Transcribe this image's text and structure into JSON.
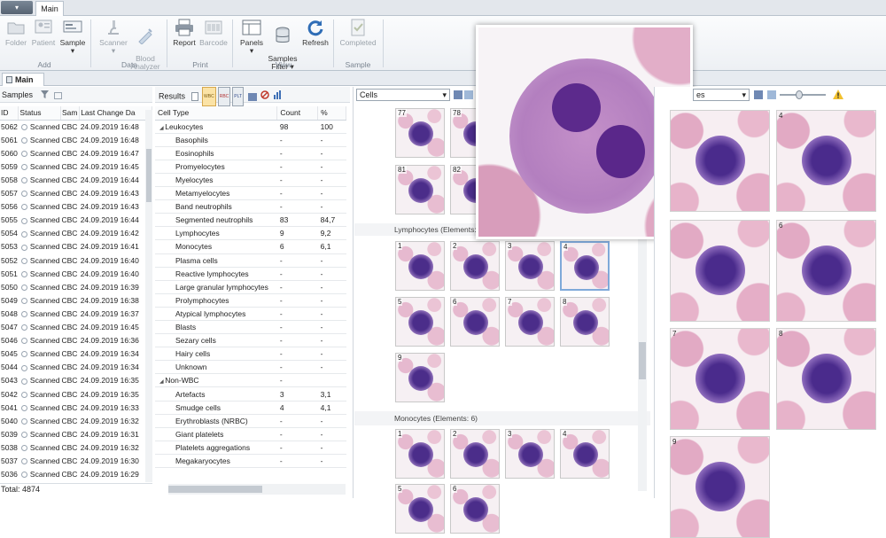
{
  "tabs": {
    "app_menu": "",
    "main": "Main"
  },
  "ribbon": {
    "groups": [
      {
        "label": "Add",
        "items": [
          {
            "label": "Folder",
            "icon": "folder-icon",
            "enabled": false
          },
          {
            "label": "Patient",
            "icon": "patient-icon",
            "enabled": false
          },
          {
            "label": "Sample",
            "icon": "sample-icon",
            "enabled": true
          }
        ]
      },
      {
        "label": "Data",
        "items": [
          {
            "label": "Scanner",
            "icon": "microscope-icon",
            "enabled": false
          },
          {
            "label": "Blood\nAnalyzer",
            "icon": "syringe-icon",
            "enabled": false
          }
        ]
      },
      {
        "label": "Print",
        "items": [
          {
            "label": "Report",
            "icon": "printer-icon",
            "enabled": true
          },
          {
            "label": "Barcode",
            "icon": "barcode-icon",
            "enabled": false
          }
        ]
      },
      {
        "label": "View",
        "items": [
          {
            "label": "Panels",
            "icon": "panels-icon",
            "enabled": true
          },
          {
            "label": "Samples\nFilter",
            "icon": "database-icon",
            "enabled": true
          },
          {
            "label": "Refresh",
            "icon": "refresh-icon",
            "enabled": true
          }
        ]
      },
      {
        "label": "Sample",
        "items": [
          {
            "label": "Completed",
            "icon": "checklist-icon",
            "enabled": false
          }
        ]
      }
    ]
  },
  "doc_tab": "Main",
  "samples": {
    "title": "Samples",
    "columns": [
      "ID",
      "Status",
      "Sam",
      "Last Change Da"
    ],
    "rows": [
      [
        "5062",
        "Scanned",
        "CBC",
        "24.09.2019 16:48"
      ],
      [
        "5061",
        "Scanned",
        "CBC",
        "24.09.2019 16:48"
      ],
      [
        "5060",
        "Scanned",
        "CBC",
        "24.09.2019 16:47"
      ],
      [
        "5059",
        "Scanned",
        "CBC",
        "24.09.2019 16:45"
      ],
      [
        "5058",
        "Scanned",
        "CBC",
        "24.09.2019 16:44"
      ],
      [
        "5057",
        "Scanned",
        "CBC",
        "24.09.2019 16:43"
      ],
      [
        "5056",
        "Scanned",
        "CBC",
        "24.09.2019 16:43"
      ],
      [
        "5055",
        "Scanned",
        "CBC",
        "24.09.2019 16:44"
      ],
      [
        "5054",
        "Scanned",
        "CBC",
        "24.09.2019 16:42"
      ],
      [
        "5053",
        "Scanned",
        "CBC",
        "24.09.2019 16:41"
      ],
      [
        "5052",
        "Scanned",
        "CBC",
        "24.09.2019 16:40"
      ],
      [
        "5051",
        "Scanned",
        "CBC",
        "24.09.2019 16:40"
      ],
      [
        "5050",
        "Scanned",
        "CBC",
        "24.09.2019 16:39"
      ],
      [
        "5049",
        "Scanned",
        "CBC",
        "24.09.2019 16:38"
      ],
      [
        "5048",
        "Scanned",
        "CBC",
        "24.09.2019 16:37"
      ],
      [
        "5047",
        "Scanned",
        "CBC",
        "24.09.2019 16:45"
      ],
      [
        "5046",
        "Scanned",
        "CBC",
        "24.09.2019 16:36"
      ],
      [
        "5045",
        "Scanned",
        "CBC",
        "24.09.2019 16:34"
      ],
      [
        "5044",
        "Scanned",
        "CBC",
        "24.09.2019 16:34"
      ],
      [
        "5043",
        "Scanned",
        "CBC",
        "24.09.2019 16:35"
      ],
      [
        "5042",
        "Scanned",
        "CBC",
        "24.09.2019 16:35"
      ],
      [
        "5041",
        "Scanned",
        "CBC",
        "24.09.2019 16:33"
      ],
      [
        "5040",
        "Scanned",
        "CBC",
        "24.09.2019 16:32"
      ],
      [
        "5039",
        "Scanned",
        "CBC",
        "24.09.2019 16:31"
      ],
      [
        "5038",
        "Scanned",
        "CBC",
        "24.09.2019 16:32"
      ],
      [
        "5037",
        "Scanned",
        "CBC",
        "24.09.2019 16:30"
      ],
      [
        "5036",
        "Scanned",
        "CBC",
        "24.09.2019 16:29"
      ]
    ],
    "total": "Total:  4874"
  },
  "results": {
    "title": "Results",
    "filters": [
      "WBC",
      "RBC",
      "PLT"
    ],
    "columns": [
      "Cell Type",
      "Count",
      "%"
    ],
    "rows": [
      {
        "name": "Leukocytes",
        "count": "98",
        "pct": "100",
        "group": true
      },
      {
        "name": "Basophils",
        "count": "-",
        "pct": "-"
      },
      {
        "name": "Eosinophils",
        "count": "-",
        "pct": "-"
      },
      {
        "name": "Promyelocytes",
        "count": "-",
        "pct": "-"
      },
      {
        "name": "Myelocytes",
        "count": "-",
        "pct": "-"
      },
      {
        "name": "Metamyelocytes",
        "count": "-",
        "pct": "-"
      },
      {
        "name": "Band neutrophils",
        "count": "-",
        "pct": "-"
      },
      {
        "name": "Segmented neutrophils",
        "count": "83",
        "pct": "84,7"
      },
      {
        "name": "Lymphocytes",
        "count": "9",
        "pct": "9,2"
      },
      {
        "name": "Monocytes",
        "count": "6",
        "pct": "6,1"
      },
      {
        "name": "Plasma cells",
        "count": "-",
        "pct": "-"
      },
      {
        "name": "Reactive lymphocytes",
        "count": "-",
        "pct": "-"
      },
      {
        "name": "Large granular lymphocytes",
        "count": "-",
        "pct": "-"
      },
      {
        "name": "Prolymphocytes",
        "count": "-",
        "pct": "-"
      },
      {
        "name": "Atypical lymphocytes",
        "count": "-",
        "pct": "-"
      },
      {
        "name": "Blasts",
        "count": "-",
        "pct": "-"
      },
      {
        "name": "Sezary cells",
        "count": "-",
        "pct": "-"
      },
      {
        "name": "Hairy cells",
        "count": "-",
        "pct": "-"
      },
      {
        "name": "Unknown",
        "count": "-",
        "pct": "-"
      },
      {
        "name": "Non-WBC",
        "count": "-",
        "pct": "",
        "group": true
      },
      {
        "name": "Artefacts",
        "count": "3",
        "pct": "3,1"
      },
      {
        "name": "Smudge cells",
        "count": "4",
        "pct": "4,1"
      },
      {
        "name": "Erythroblasts (NRBC)",
        "count": "-",
        "pct": "-"
      },
      {
        "name": "Giant platelets",
        "count": "-",
        "pct": "-"
      },
      {
        "name": "Platelets aggregations",
        "count": "-",
        "pct": "-"
      },
      {
        "name": "Megakaryocytes",
        "count": "-",
        "pct": "-"
      }
    ]
  },
  "gallery": {
    "dropdown": "Cells",
    "top_nums": [
      "77",
      "78",
      "81",
      "82"
    ],
    "lymph_header": "Lymphocytes (Elements: 9",
    "lymph_nums": [
      "1",
      "2",
      "3",
      "4",
      "5",
      "6",
      "7",
      "8",
      "9"
    ],
    "mono_header": "Monocytes (Elements: 6)",
    "mono_nums": [
      "1",
      "2",
      "3",
      "4",
      "5",
      "6"
    ]
  },
  "viewer": {
    "dropdown": "es",
    "nums": [
      "4",
      "6",
      "7",
      "8",
      "9"
    ]
  },
  "colors": {
    "accent": "#3d6fb5",
    "cell_stain": "#4b2d8a",
    "rbc": "#e6b1c9"
  }
}
